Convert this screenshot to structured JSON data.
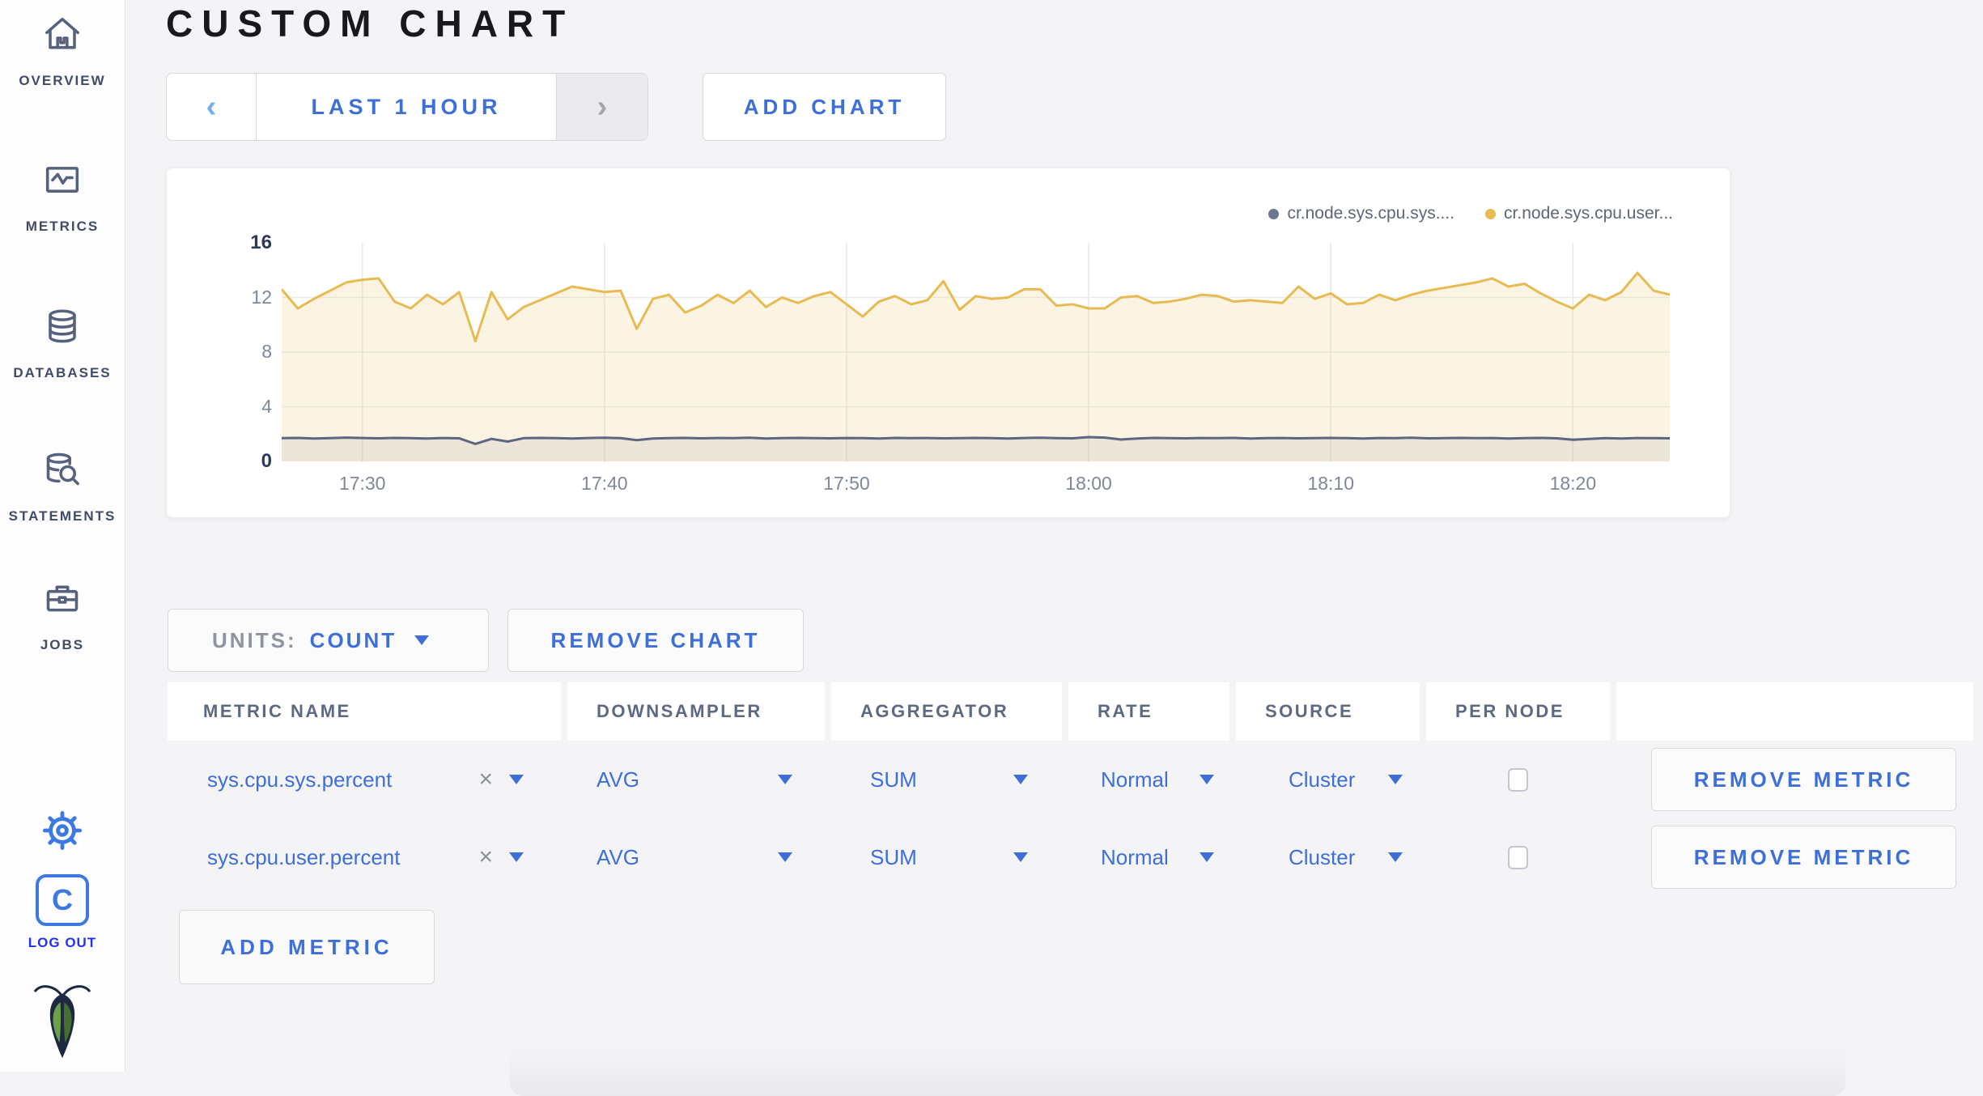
{
  "header": {
    "title": "CUSTOM CHART"
  },
  "time_selector": {
    "prev": "‹",
    "label": "LAST 1 HOUR",
    "next": "›"
  },
  "add_chart_label": "ADD CHART",
  "sidebar": {
    "items": [
      {
        "label": "OVERVIEW",
        "icon": "home-icon"
      },
      {
        "label": "METRICS",
        "icon": "metrics-icon"
      },
      {
        "label": "DATABASES",
        "icon": "databases-icon"
      },
      {
        "label": "STATEMENTS",
        "icon": "statements-icon"
      },
      {
        "label": "JOBS",
        "icon": "jobs-icon"
      }
    ],
    "settings_icon": "gear-icon",
    "logout": {
      "monogram": "C",
      "label": "LOG OUT"
    },
    "logo_icon": "cockroach-bug-logo"
  },
  "units": {
    "label": "UNITS:",
    "value": "COUNT"
  },
  "remove_chart_label": "REMOVE CHART",
  "add_metric_label": "ADD METRIC",
  "table": {
    "columns": [
      "METRIC NAME",
      "DOWNSAMPLER",
      "AGGREGATOR",
      "RATE",
      "SOURCE",
      "PER NODE",
      ""
    ],
    "rows": [
      {
        "metric": "sys.cpu.sys.percent",
        "clear": "×",
        "downsampler": "AVG",
        "aggregator": "SUM",
        "rate": "Normal",
        "source": "Cluster",
        "per_node_checked": false,
        "action_label": "REMOVE METRIC"
      },
      {
        "metric": "sys.cpu.user.percent",
        "clear": "×",
        "downsampler": "AVG",
        "aggregator": "SUM",
        "rate": "Normal",
        "source": "Cluster",
        "per_node_checked": false,
        "action_label": "REMOVE METRIC"
      }
    ]
  },
  "chart_data": {
    "type": "line",
    "title": "",
    "xlabel": "",
    "ylabel": "",
    "ylim": [
      0,
      16
    ],
    "y_ticks": [
      0,
      4,
      8,
      12,
      16
    ],
    "grid": true,
    "legend_position": "top-right",
    "x_ticks": [
      "17:30",
      "17:40",
      "17:50",
      "18:00",
      "18:10",
      "18:20"
    ],
    "x_tick_indices": [
      5,
      20,
      35,
      50,
      65,
      80
    ],
    "x_interval_seconds": 40,
    "series": [
      {
        "name": "cr.node.sys.cpu.sys....",
        "color": "#5b6680",
        "dot_color": "#6b7690",
        "fill": "rgba(91,102,128,0.10)",
        "values": [
          1.7,
          1.72,
          1.68,
          1.7,
          1.74,
          1.71,
          1.69,
          1.72,
          1.7,
          1.67,
          1.71,
          1.69,
          1.28,
          1.65,
          1.45,
          1.7,
          1.72,
          1.7,
          1.68,
          1.71,
          1.73,
          1.7,
          1.55,
          1.68,
          1.7,
          1.72,
          1.69,
          1.71,
          1.7,
          1.73,
          1.68,
          1.7,
          1.72,
          1.7,
          1.69,
          1.71,
          1.7,
          1.68,
          1.72,
          1.7,
          1.71,
          1.69,
          1.7,
          1.72,
          1.7,
          1.68,
          1.71,
          1.73,
          1.7,
          1.69,
          1.78,
          1.74,
          1.6,
          1.68,
          1.72,
          1.7,
          1.69,
          1.71,
          1.7,
          1.72,
          1.68,
          1.7,
          1.71,
          1.69,
          1.7,
          1.72,
          1.7,
          1.68,
          1.71,
          1.7,
          1.73,
          1.69,
          1.7,
          1.72,
          1.7,
          1.71,
          1.68,
          1.7,
          1.72,
          1.69,
          1.58,
          1.64,
          1.7,
          1.68,
          1.71,
          1.7,
          1.69
        ]
      },
      {
        "name": "cr.node.sys.cpu.user...",
        "color": "#e7ba52",
        "dot_color": "#e7ba52",
        "fill": "rgba(231,186,82,0.16)",
        "values": [
          12.6,
          11.2,
          11.9,
          12.5,
          13.1,
          13.3,
          13.4,
          11.7,
          11.2,
          12.2,
          11.5,
          12.4,
          8.8,
          12.4,
          10.4,
          11.3,
          11.8,
          12.3,
          12.8,
          12.6,
          12.4,
          12.5,
          9.7,
          11.9,
          12.2,
          10.9,
          11.4,
          12.2,
          11.6,
          12.5,
          11.3,
          12.0,
          11.6,
          12.1,
          12.4,
          11.5,
          10.6,
          11.7,
          12.1,
          11.5,
          11.8,
          13.2,
          11.1,
          12.1,
          11.9,
          12.0,
          12.6,
          12.6,
          11.4,
          11.5,
          11.2,
          11.2,
          12.0,
          12.1,
          11.6,
          11.7,
          11.9,
          12.2,
          12.1,
          11.7,
          11.8,
          11.7,
          11.6,
          12.8,
          11.9,
          12.3,
          11.5,
          11.6,
          12.2,
          11.8,
          12.2,
          12.5,
          12.7,
          12.9,
          13.1,
          13.4,
          12.8,
          13.0,
          12.3,
          11.7,
          11.2,
          12.2,
          11.8,
          12.4,
          13.8,
          12.5,
          12.2
        ]
      }
    ]
  },
  "colors": {
    "accent_blue": "#3d6fd7",
    "logout_blue": "#2430ee",
    "icon_slate": "#55617d",
    "grid_line": "#e7e8ec",
    "axis_text": "#7e8899",
    "axis_text_strong": "#2d3a57"
  }
}
